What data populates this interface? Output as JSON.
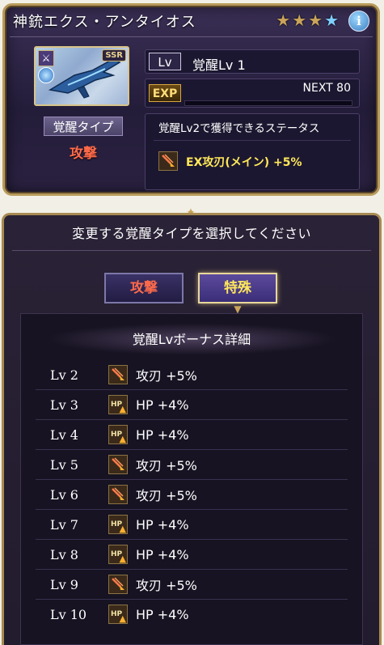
{
  "card": {
    "title": "神銃エクス・アンタイオス",
    "stars_filled": 3,
    "stars_total": 4,
    "info_label": "i",
    "ssr_badge": "SSR",
    "weapon_type_glyph": "⚔",
    "type_label": "覚醒タイプ",
    "type_value": "攻撃",
    "lv_tag": "Lv",
    "lv_text": "覚醒Lv 1",
    "exp_tag": "EXP",
    "exp_next": "NEXT 80",
    "exp_progress": 0,
    "next_title": "覚醒Lv2で獲得できるステータス",
    "next_bonus": "EX攻刃(メイン) +5%"
  },
  "panel": {
    "header": "変更する覚醒タイプを選択してください",
    "buttons": {
      "attack": "攻撃",
      "special": "特殊"
    },
    "selected": "special",
    "bonus_heading": "覚醒Lvボーナス詳細",
    "bonuses": [
      {
        "lv": "Lv 2",
        "icon": "atk",
        "text": "攻刃 +5%"
      },
      {
        "lv": "Lv 3",
        "icon": "hp",
        "text": "HP +4%"
      },
      {
        "lv": "Lv 4",
        "icon": "hp",
        "text": "HP +4%"
      },
      {
        "lv": "Lv 5",
        "icon": "atk",
        "text": "攻刃 +5%"
      },
      {
        "lv": "Lv 6",
        "icon": "atk",
        "text": "攻刃 +5%"
      },
      {
        "lv": "Lv 7",
        "icon": "hp",
        "text": "HP +4%"
      },
      {
        "lv": "Lv 8",
        "icon": "hp",
        "text": "HP +4%"
      },
      {
        "lv": "Lv 9",
        "icon": "atk",
        "text": "攻刃 +5%"
      },
      {
        "lv": "Lv 10",
        "icon": "hp",
        "text": "HP +4%"
      }
    ],
    "hp_icon_label": "HP"
  },
  "colors": {
    "attack_red": "#ff6a4a",
    "special_yellow": "#ffe85a",
    "gold_border": "#b99a5a"
  }
}
